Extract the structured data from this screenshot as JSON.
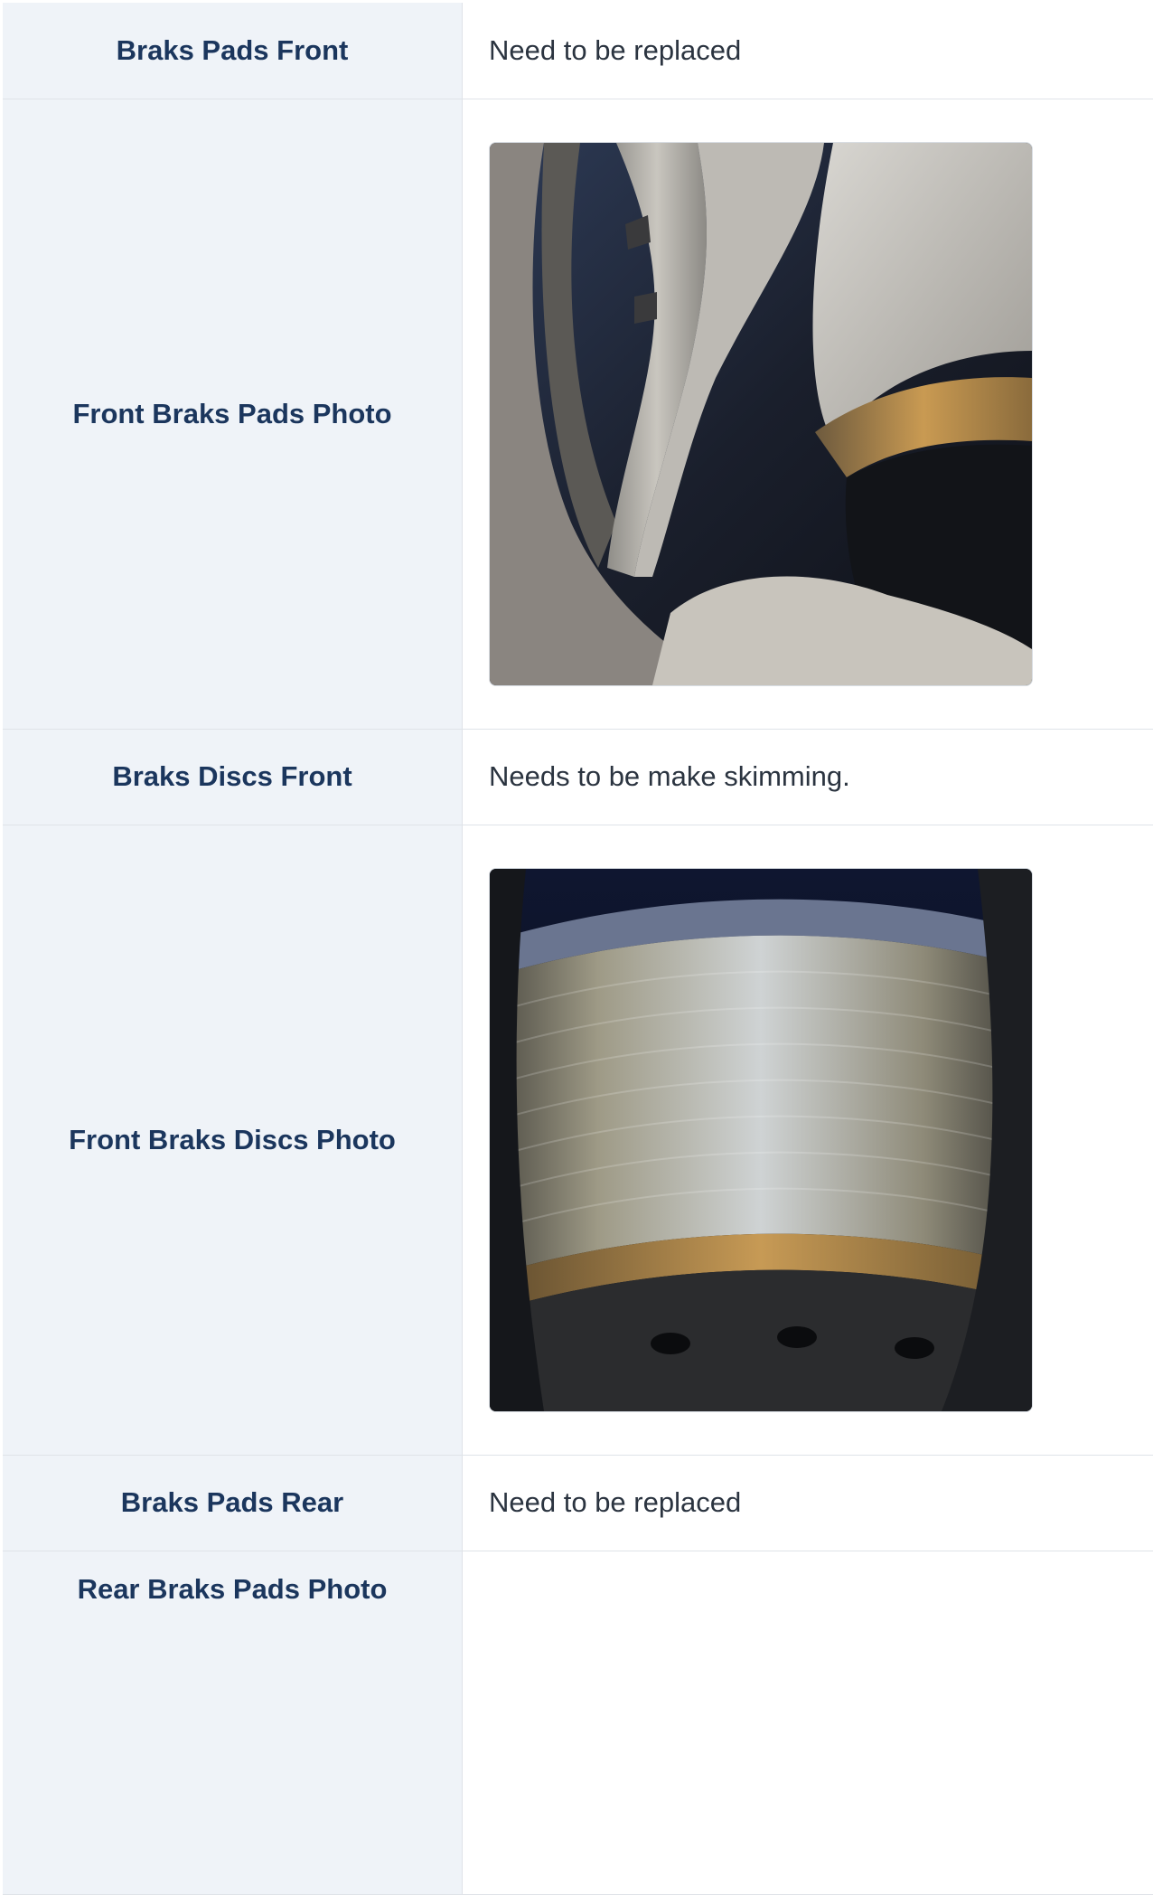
{
  "inspection": {
    "rows": [
      {
        "label": "Braks Pads Front",
        "value": "Need to be replaced"
      },
      {
        "label": "Front Braks Pads Photo",
        "photo": "front-brake-pads-photo"
      },
      {
        "label": "Braks Discs Front",
        "value": "Needs to be make skimming."
      },
      {
        "label": "Front Braks Discs Photo",
        "photo": "front-brake-discs-photo"
      },
      {
        "label": "Braks Pads Rear",
        "value": "Need to be replaced"
      },
      {
        "label": "Rear Braks Pads Photo",
        "value": ""
      }
    ]
  },
  "colors": {
    "label_background": "#eff3f8",
    "label_text": "#1b365d",
    "value_text": "#2b3440",
    "border": "#dfe3e8"
  }
}
